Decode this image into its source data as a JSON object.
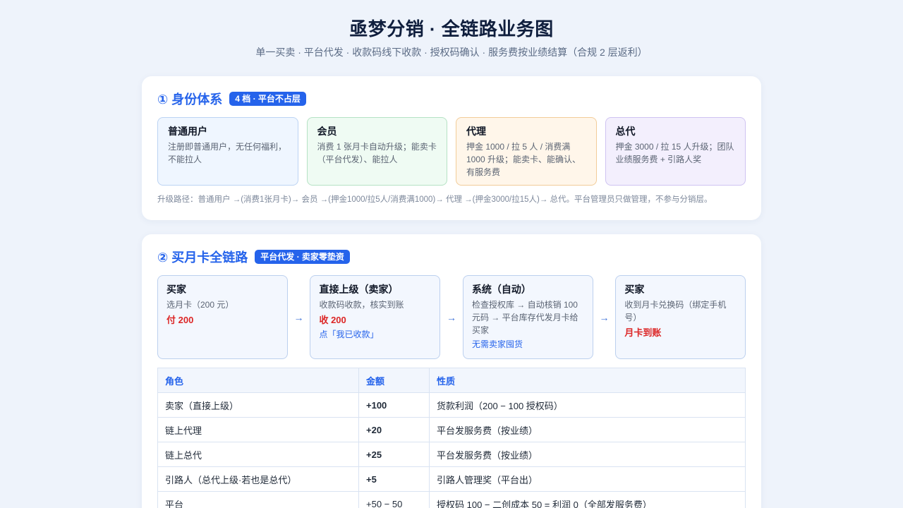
{
  "header": {
    "title": "亟梦分销 · 全链路业务图",
    "subtitle": "单一买卖 · 平台代发 · 收款码线下收款 · 授权码确认 · 服务费按业绩结算（合规 2 层返利）"
  },
  "identity": {
    "title": "① 身份体系",
    "badge": "4 档 · 平台不占层",
    "tiers": [
      {
        "name": "普通用户",
        "desc": "注册即普通用户，无任何福利，不能拉人"
      },
      {
        "name": "会员",
        "desc": "消费 1 张月卡自动升级；能卖卡（平台代发）、能拉人"
      },
      {
        "name": "代理",
        "desc": "押金 1000 / 拉 5 人 / 消费满 1000 升级；能卖卡、能确认、有服务费"
      },
      {
        "name": "总代",
        "desc": "押金 3000 / 拉 15 人升级；团队业绩服务费 + 引路人奖"
      }
    ],
    "upgrade_path": "升级路径：普通用户 →(消费1张月卡)→ 会员 →(押金1000/拉5人/消费满1000)→ 代理 →(押金3000/拉15人)→ 总代。平台管理员只做管理，不参与分销层。"
  },
  "flow": {
    "title": "② 买月卡全链路",
    "badge": "平台代发 · 卖家零垫资",
    "arrow": "→",
    "steps": [
      {
        "title": "买家",
        "desc": "选月卡（200 元）",
        "amount": "付 200",
        "note": ""
      },
      {
        "title": "直接上级（卖家）",
        "desc": "收款码收款，核实到账",
        "amount": "收 200",
        "note": "点「我已收款」"
      },
      {
        "title": "系统（自动）",
        "desc": "检查授权库 → 自动核销 100 元码 → 平台库存代发月卡给买家",
        "amount": "",
        "note": "无需卖家囤货"
      },
      {
        "title": "买家",
        "desc": "收到月卡兑换码（绑定手机号）",
        "amount": "月卡到账",
        "note": ""
      }
    ],
    "table": {
      "headers": [
        "角色",
        "金额",
        "性质"
      ],
      "rows": [
        {
          "role": "卖家（直接上级）",
          "amount": "+100",
          "nature": "货款利润（200 − 100 授权码）"
        },
        {
          "role": "链上代理",
          "amount": "+20",
          "nature": "平台发服务费（按业绩）"
        },
        {
          "role": "链上总代",
          "amount": "+25",
          "nature": "平台发服务费（按业绩）"
        },
        {
          "role": "引路人（总代上级·若也是总代）",
          "amount": "+5",
          "nature": "引路人管理奖（平台出）"
        },
        {
          "role": "平台",
          "amount": "+50 − 50",
          "nature": "授权码 100 − 二创成本 50 = 利润 0（全部发服务费）"
        }
      ]
    }
  },
  "colors": {
    "accent": "#2563eb",
    "positive": "#16a34a",
    "negative": "#dc2626",
    "background": "#eef3fb"
  }
}
